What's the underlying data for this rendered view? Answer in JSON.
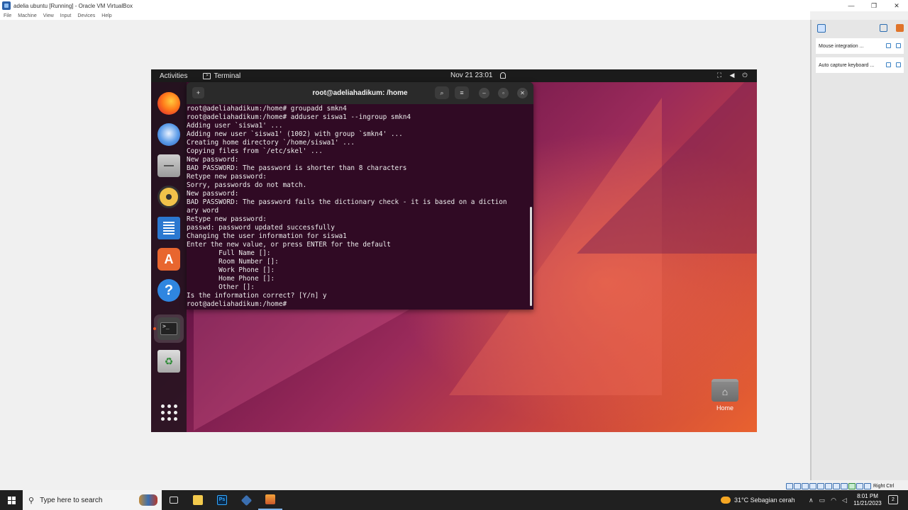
{
  "window": {
    "title": "adelia ubuntu [Running] - Oracle VM VirtualBox",
    "controls": [
      "—",
      "❐",
      "✕"
    ]
  },
  "menubar": [
    "File",
    "Machine",
    "View",
    "Input",
    "Devices",
    "Help"
  ],
  "side_panel": {
    "rows": [
      {
        "label": "Mouse integration ..."
      },
      {
        "label": "Auto capture keyboard ..."
      }
    ]
  },
  "status_bar": {
    "host_key": "Right Ctrl"
  },
  "ubuntu": {
    "topbar": {
      "activities": "Activities",
      "app_name": "Terminal",
      "clock": "Nov 21  23:01"
    },
    "terminal": {
      "title": "root@adeliahadikum: /home",
      "lines": [
        "root@adeliahadikum:/home# groupadd smkn4",
        "root@adeliahadikum:/home# adduser siswa1 --ingroup smkn4",
        "Adding user `siswa1' ...",
        "Adding new user `siswa1' (1002) with group `smkn4' ...",
        "Creating home directory `/home/siswa1' ...",
        "Copying files from `/etc/skel' ...",
        "New password:",
        "BAD PASSWORD: The password is shorter than 8 characters",
        "Retype new password:",
        "Sorry, passwords do not match.",
        "New password:",
        "BAD PASSWORD: The password fails the dictionary check - it is based on a diction",
        "ary word",
        "Retype new password:",
        "passwd: password updated successfully",
        "Changing the user information for siswa1",
        "Enter the new value, or press ENTER for the default",
        "        Full Name []:",
        "        Room Number []:",
        "        Work Phone []:",
        "        Home Phone []:",
        "        Other []:",
        "Is the information correct? [Y/n] y",
        "root@adeliahadikum:/home#"
      ]
    },
    "desktop": {
      "home_label": "Home"
    }
  },
  "taskbar": {
    "search_placeholder": "Type here to search",
    "weather": "31°C  Sebagian cerah",
    "time": "8:01 PM",
    "date": "11/21/2023",
    "notifications": "2"
  }
}
